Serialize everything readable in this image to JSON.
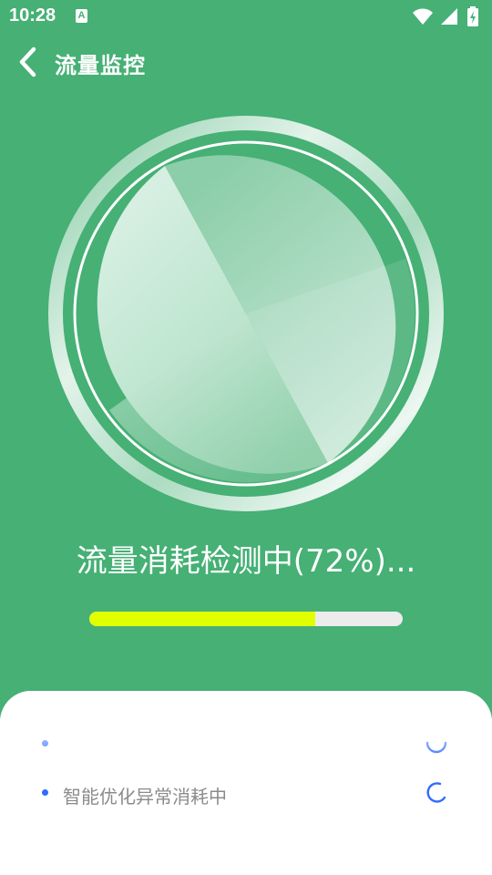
{
  "status_bar": {
    "time": "10:28",
    "a_icon": "A",
    "icons": [
      "wifi-icon",
      "cellular-icon",
      "battery-charging-icon"
    ]
  },
  "header": {
    "back_icon": "back-chevron-icon",
    "title": "流量监控"
  },
  "scan": {
    "status_text": "流量消耗检测中(72%)...",
    "progress": 0.72,
    "progress_color": "#e2ff00",
    "track_color": "#ececec"
  },
  "tasks": [
    {
      "label": "",
      "state": "in-progress",
      "spinner_icon": "spinner-icon"
    },
    {
      "label": "智能优化异常消耗中",
      "state": "in-progress",
      "spinner_icon": "spinner-icon"
    }
  ],
  "colors": {
    "background": "#46b075",
    "accent_blue": "#2f6bff",
    "text_gray": "#8b8b8b"
  }
}
